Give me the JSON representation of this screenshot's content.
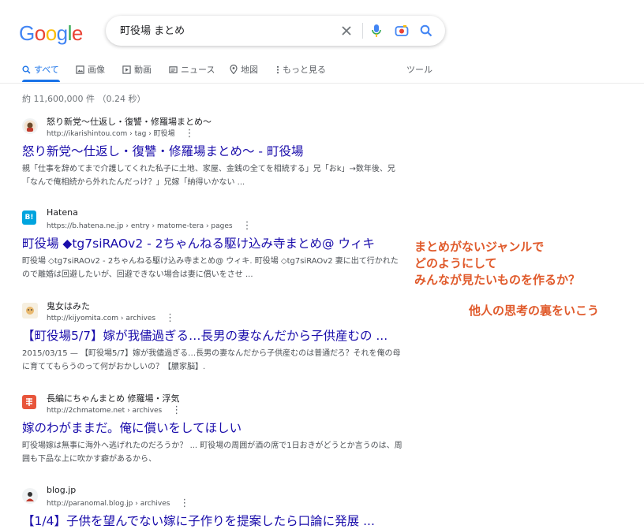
{
  "logo": {
    "letters": [
      "G",
      "o",
      "o",
      "g",
      "l",
      "e"
    ],
    "colors": [
      "#4285F4",
      "#EA4335",
      "#FBBC05",
      "#4285F4",
      "#34A853",
      "#EA4335"
    ]
  },
  "search": {
    "query": "町役場 まとめ",
    "icons": [
      "close-icon",
      "mic-icon",
      "camera-lens-icon",
      "search-icon"
    ]
  },
  "tabs": [
    {
      "label": "すべて",
      "icon": "search-icon",
      "active": true
    },
    {
      "label": "画像",
      "icon": "image-icon"
    },
    {
      "label": "動画",
      "icon": "play-icon"
    },
    {
      "label": "ニュース",
      "icon": "news-icon"
    },
    {
      "label": "地図",
      "icon": "pin-icon"
    },
    {
      "label": "もっと見る",
      "icon": "more-vert-icon"
    }
  ],
  "tools_label": "ツール",
  "stats": "約 11,600,000 件 （0.24 秒）",
  "results": [
    {
      "site": "怒り新党〜仕返し・復讐・修羅場まとめ〜",
      "url": "http://ikarishintou.com › tag › 町役場",
      "title": "怒り新党〜仕返し・復讐・修羅場まとめ〜 - 町役場",
      "snippet": "親「仕事を辞めてまで介護してくれた私子に土地、家屋、金銭の全てを相続する」兄「おk」→数年後、兄「なんで俺相続から外れたんだっけ？」兄嫁「納得いかない ..."
    },
    {
      "site": "Hatena",
      "url": "https://b.hatena.ne.jp › entry › matome-tera › pages",
      "title": "町役場 ◆tg7siRAOv2 - 2ちゃんねる駆け込み寺まとめ@ ウィキ",
      "snippet": "町役場 ◇tg7siRAOv2 - 2ちゃんねる駆け込み寺まとめ@ ウィキ. 町役場 ◇tg7siRAOv2 妻に出て行かれたので離婚は回避したいが、回避できない場合は妻に償いをさせ ..."
    },
    {
      "site": "鬼女はみた",
      "url": "http://kijyomita.com › archives",
      "title": "【町役場5/7】嫁が我儘過ぎる…長男の妻なんだから子供産むの ...",
      "snippet": "2015/03/15 — 【町役場5/7】嫁が我儘過ぎる…長男の妻なんだから子供産むのは普通だろ？それを俺の母に育ててもらうのって何がおかしいの？【膿家脳】."
    },
    {
      "site": "長編にちゃんまとめ 修羅場・浮気",
      "url": "http://2chmatome.net › archives",
      "title": "嫁のわがままだ。俺に償いをしてほしい",
      "snippet": "町役場嫁は無事に海外へ逃げれたのだろうか？ ... 町役場の周囲が酒の席で1日おきがどうとか言うのは、周囲も下品な上に吹かす癖があるから、"
    },
    {
      "site": "blog.jp",
      "url": "http://paranomal.blog.jp › archives",
      "title": "【1/4】子供を望んでない嫁に子作りを提案したら口論に発展 ..."
    }
  ],
  "annotations": {
    "line1": "まとめがないジャンルで",
    "line2": "どのようにして",
    "line3": "みんなが見たいものを作るか？",
    "line4": "他人の思考の裏をいこう",
    "color": "#e05a2b"
  }
}
